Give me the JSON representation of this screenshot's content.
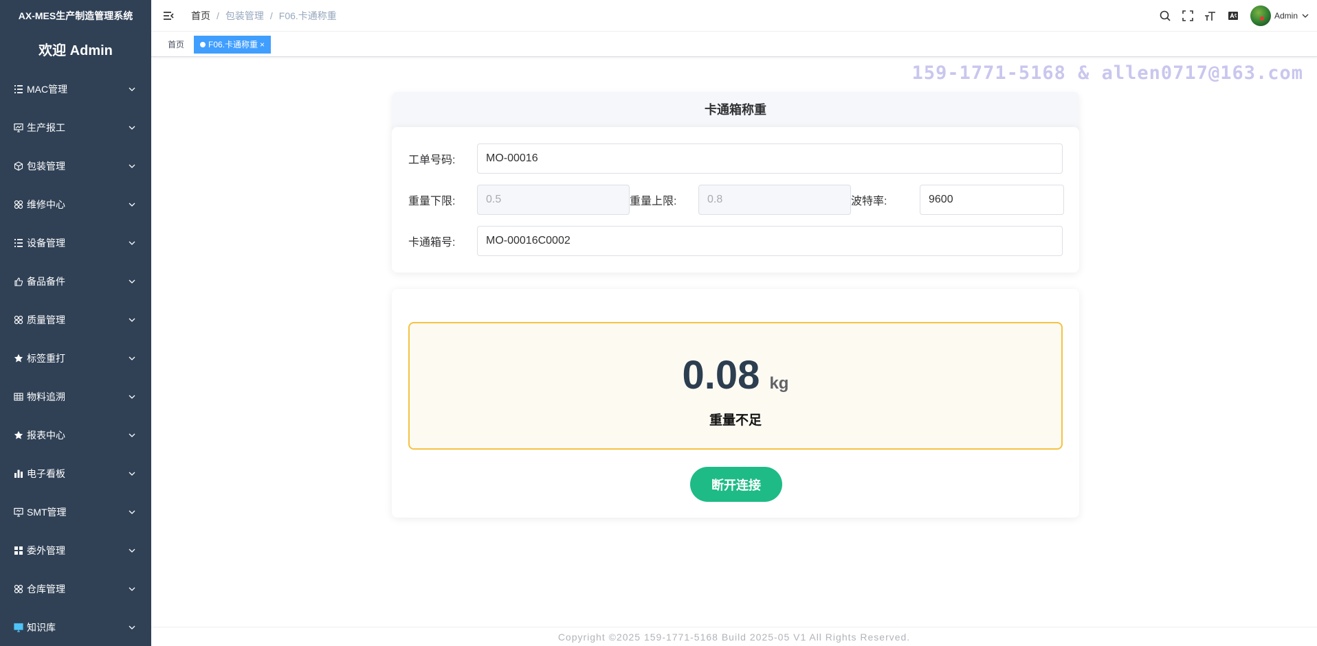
{
  "sidebar": {
    "system_title": "AX-MES生产制造管理系统",
    "welcome": "欢迎 Admin",
    "items": [
      {
        "label": "MAC管理",
        "icon": "list-icon"
      },
      {
        "label": "生产报工",
        "icon": "monitor-chart-icon"
      },
      {
        "label": "包装管理",
        "icon": "box-icon"
      },
      {
        "label": "维修中心",
        "icon": "grid-flower-icon"
      },
      {
        "label": "设备管理",
        "icon": "list-icon"
      },
      {
        "label": "备品备件",
        "icon": "hand-icon"
      },
      {
        "label": "质量管理",
        "icon": "grid-flower-icon"
      },
      {
        "label": "标签重打",
        "icon": "star-icon"
      },
      {
        "label": "物料追溯",
        "icon": "table-icon"
      },
      {
        "label": "报表中心",
        "icon": "star-icon"
      },
      {
        "label": "电子看板",
        "icon": "bar-chart-icon"
      },
      {
        "label": "SMT管理",
        "icon": "monitor-icon"
      },
      {
        "label": "委外管理",
        "icon": "apps-icon"
      },
      {
        "label": "仓库管理",
        "icon": "grid-flower-icon"
      },
      {
        "label": "知识库",
        "icon": "monitor-blue-icon"
      }
    ]
  },
  "header": {
    "breadcrumb": [
      "首页",
      "包装管理",
      "F06.卡通称重"
    ],
    "user_name": "Admin"
  },
  "tags": [
    {
      "label": "首页",
      "active": false
    },
    {
      "label": "F06.卡通称重",
      "active": true,
      "close": "×"
    }
  ],
  "watermark": "159-1771-5168 & allen0717@163.com",
  "form": {
    "title": "卡通箱称重",
    "work_order_label": "工单号码:",
    "work_order_value": "MO-00016",
    "weight_lower_label": "重量下限:",
    "weight_lower_value": "0.5",
    "weight_upper_label": "重量上限:",
    "weight_upper_value": "0.8",
    "baud_label": "波特率:",
    "baud_value": "9600",
    "carton_label": "卡通箱号:",
    "carton_value": "MO-00016C0002"
  },
  "weight": {
    "value": "0.08",
    "unit": "kg",
    "status": "重量不足",
    "disconnect_label": "断开连接",
    "accent_color": "#f5c242",
    "button_color": "#1ebb87"
  },
  "footer": {
    "text": "Copyright ©2025 159-1771-5168 Build 2025-05 V1 All Rights Reserved."
  }
}
